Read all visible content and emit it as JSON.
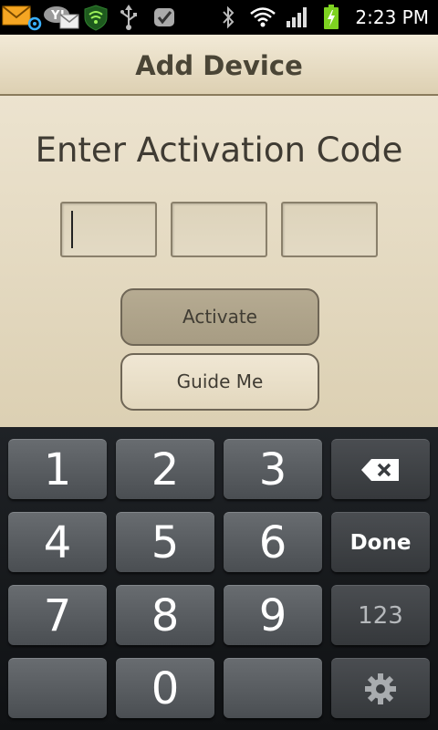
{
  "status_bar": {
    "time": "2:23 PM",
    "icons": [
      "email-icon",
      "messages-icon",
      "shield-icon",
      "usb-icon",
      "check-icon",
      "bluetooth-icon",
      "wifi-icon",
      "signal-icon",
      "battery-icon"
    ]
  },
  "header": {
    "title": "Add Device"
  },
  "main": {
    "heading": "Enter Activation Code",
    "code_fields": [
      "",
      "",
      ""
    ],
    "activate_label": "Activate",
    "guide_label": "Guide Me"
  },
  "keyboard": {
    "keys": [
      "1",
      "2",
      "3",
      "4",
      "5",
      "6",
      "7",
      "8",
      "9",
      "0"
    ],
    "done_label": "Done",
    "mode_label": "123",
    "backspace_icon": "backspace-icon",
    "settings_icon": "gear-icon"
  },
  "colors": {
    "background": "#d8cdb1",
    "title_text": "#4a4536",
    "activate_button": "#aea38a",
    "keyboard_background": "#16181b",
    "battery": "#7ed321"
  }
}
